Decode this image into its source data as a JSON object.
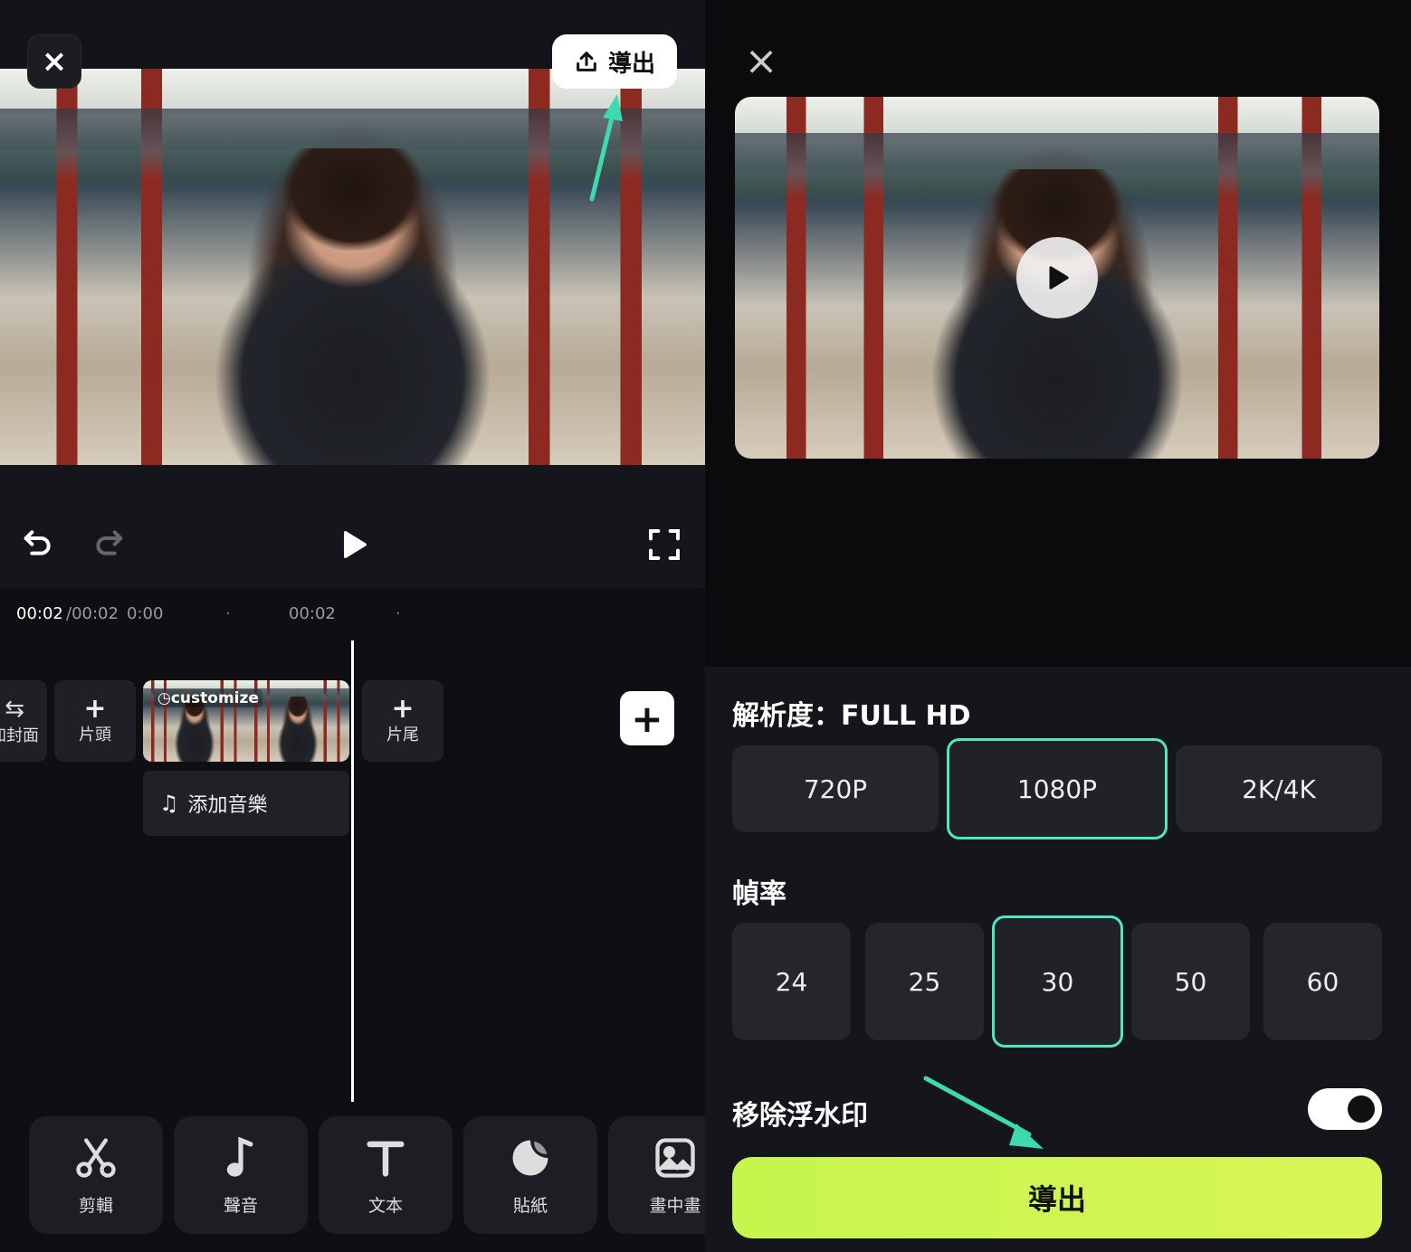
{
  "left": {
    "close_icon": "×",
    "export_label": "導出",
    "time_current": "00:02",
    "time_total": "/00:02",
    "ruler": [
      "0:00",
      "00:02"
    ],
    "cover_label": "加封面",
    "intro_label": "片頭",
    "outro_label": "片尾",
    "clip_badge": "customize",
    "music_label": "添加音樂",
    "tools": [
      {
        "label": "剪輯",
        "icon": "scissors-icon"
      },
      {
        "label": "聲音",
        "icon": "music-note-icon"
      },
      {
        "label": "文本",
        "icon": "text-icon"
      },
      {
        "label": "貼紙",
        "icon": "sticker-icon"
      },
      {
        "label": "畫中畫",
        "icon": "picture-in-picture-icon"
      }
    ]
  },
  "right": {
    "close_icon": "×",
    "resolution_label": "解析度：FULL HD",
    "resolutions": [
      "720P",
      "1080P",
      "2K/4K"
    ],
    "resolution_selected": "1080P",
    "framerate_label": "幀率",
    "framerates": [
      "24",
      "25",
      "30",
      "50",
      "60"
    ],
    "framerate_selected": "30",
    "watermark_label": "移除浮水印",
    "watermark_enabled": true,
    "export_label": "導出"
  },
  "colors": {
    "accent": "#53e4c0",
    "export": "#c6f54c",
    "arrow": "#3fd9b0"
  }
}
